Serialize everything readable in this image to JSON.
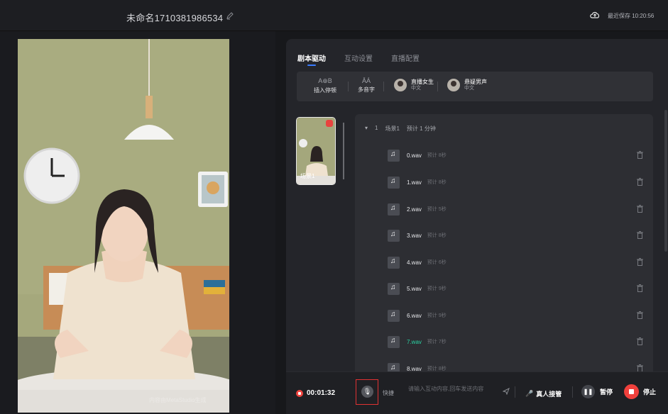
{
  "header": {
    "title": "未命名1710381986534",
    "save_status": "最近保存 10:20:56"
  },
  "tabs": [
    {
      "label": "剧本驱动",
      "active": true
    },
    {
      "label": "互动设置",
      "active": false
    },
    {
      "label": "直播配置",
      "active": false
    }
  ],
  "toolbar": {
    "pause_glyph": "A⊕B",
    "pause_label": "插入停顿",
    "poly_glyph": "ĀÁ",
    "poly_label": "多音字",
    "voices": [
      {
        "name": "直播女生",
        "lang": "中文"
      },
      {
        "name": "悬疑男声",
        "lang": "中文"
      }
    ]
  },
  "scenes": [
    {
      "label": "场景1"
    }
  ],
  "scene_card": {
    "index": "1",
    "name": "场景1",
    "estimate": "预计 1 分钟",
    "files": [
      {
        "name": "0.wav",
        "est": "预计 8秒",
        "highlight": false
      },
      {
        "name": "1.wav",
        "est": "预计 8秒",
        "highlight": false
      },
      {
        "name": "2.wav",
        "est": "预计 5秒",
        "highlight": false
      },
      {
        "name": "3.wav",
        "est": "预计 8秒",
        "highlight": false
      },
      {
        "name": "4.wav",
        "est": "预计 6秒",
        "highlight": false
      },
      {
        "name": "5.wav",
        "est": "预计 9秒",
        "highlight": false
      },
      {
        "name": "6.wav",
        "est": "预计 9秒",
        "highlight": false
      },
      {
        "name": "7.wav",
        "est": "预计 7秒",
        "highlight": true
      },
      {
        "name": "8.wav",
        "est": "预计 8秒",
        "highlight": false
      }
    ]
  },
  "preview": {
    "watermark": "内容由MetaStudio生成"
  },
  "bottom": {
    "timer": "00:01:32",
    "quick_label": "快捷",
    "input_placeholder": "请输入互动内容,回车发送内容",
    "takeover_label": "真人接管",
    "pause_label": "暂停",
    "stop_label": "停止"
  }
}
